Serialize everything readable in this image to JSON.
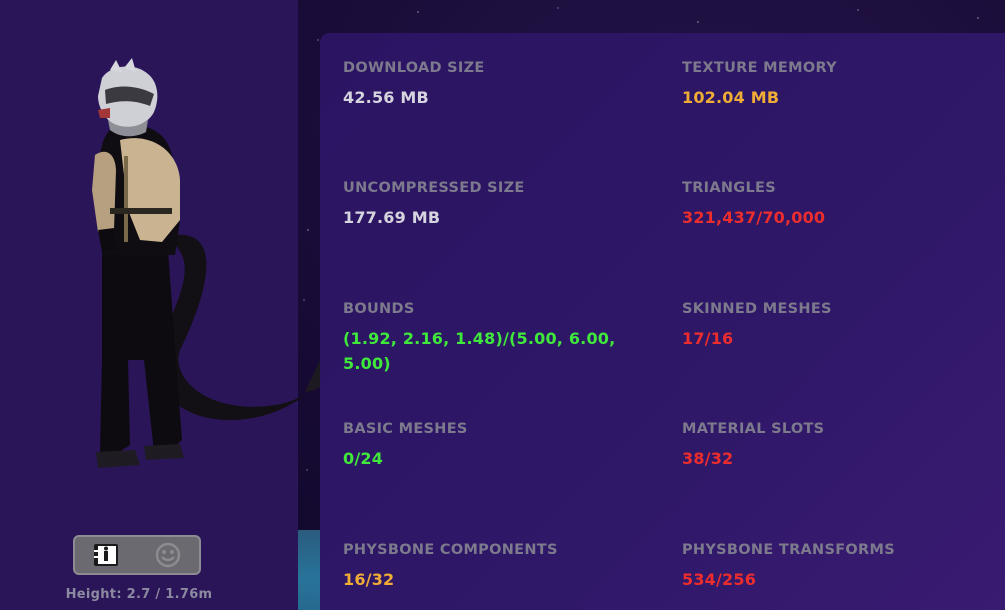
{
  "avatar": {
    "height_text": "Height: 2.7 / 1.76m"
  },
  "toggle": {
    "buttons": [
      "info-icon",
      "face-icon"
    ]
  },
  "colors": {
    "label": "#7d7a8d",
    "good": "#3fe83b",
    "warning": "#f0ad36",
    "bad": "#ec2d2d",
    "neutral": "#d6d4de"
  },
  "stats": {
    "download_size": {
      "label": "DOWNLOAD SIZE",
      "value": "42.56 MB"
    },
    "texture_memory": {
      "label": "TEXTURE MEMORY",
      "value": "102.04 MB"
    },
    "uncompressed_size": {
      "label": "UNCOMPRESSED SIZE",
      "value": "177.69 MB"
    },
    "triangles": {
      "label": "TRIANGLES",
      "value": "321,437/70,000"
    },
    "bounds": {
      "label": "BOUNDS",
      "value": "(1.92, 2.16, 1.48)/(5.00, 6.00, 5.00)"
    },
    "skinned_meshes": {
      "label": "SKINNED MESHES",
      "value": "17/16"
    },
    "basic_meshes": {
      "label": "BASIC MESHES",
      "value": "0/24"
    },
    "material_slots": {
      "label": "MATERIAL SLOTS",
      "value": "38/32"
    },
    "physbone_components": {
      "label": "PHYSBONE COMPONENTS",
      "value": "16/32"
    },
    "physbone_transforms": {
      "label": "PHYSBONE TRANSFORMS",
      "value": "534/256"
    }
  }
}
